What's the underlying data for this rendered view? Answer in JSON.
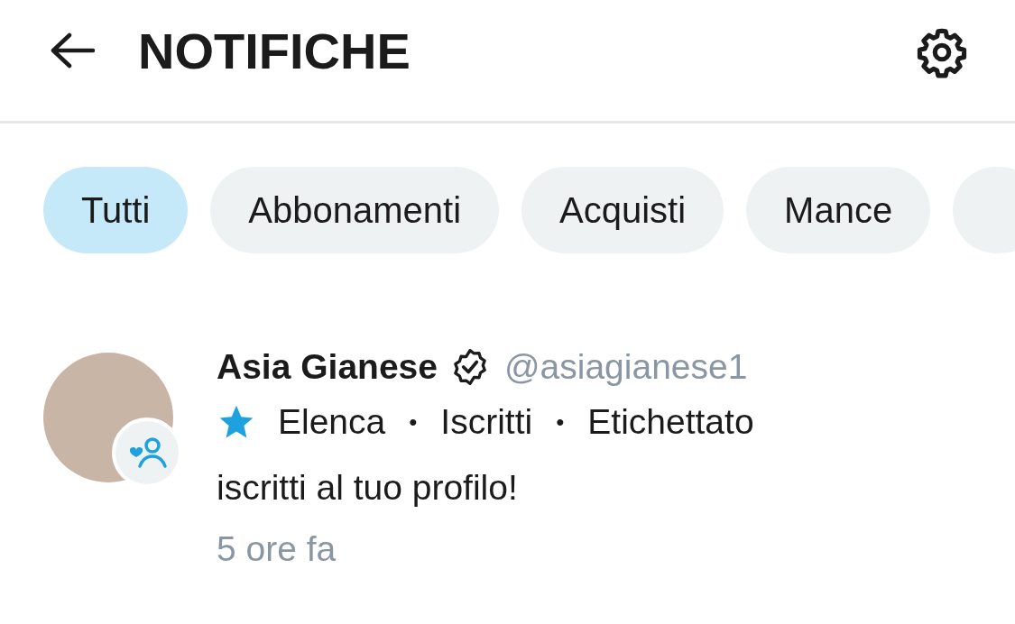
{
  "header": {
    "title": "NOTIFICHE"
  },
  "filters": [
    {
      "label": "Tutti",
      "selected": true
    },
    {
      "label": "Abbonamenti",
      "selected": false
    },
    {
      "label": "Acquisti",
      "selected": false
    },
    {
      "label": "Mance",
      "selected": false
    }
  ],
  "notifications": [
    {
      "name": "Asia Gianese",
      "verified": true,
      "handle": "@asiagianese1",
      "tags": [
        "Elenca",
        "Iscritti",
        "Etichettato"
      ],
      "separator": "•",
      "message": "iscritti al tuo profilo!",
      "time": "5 ore fa"
    }
  ]
}
